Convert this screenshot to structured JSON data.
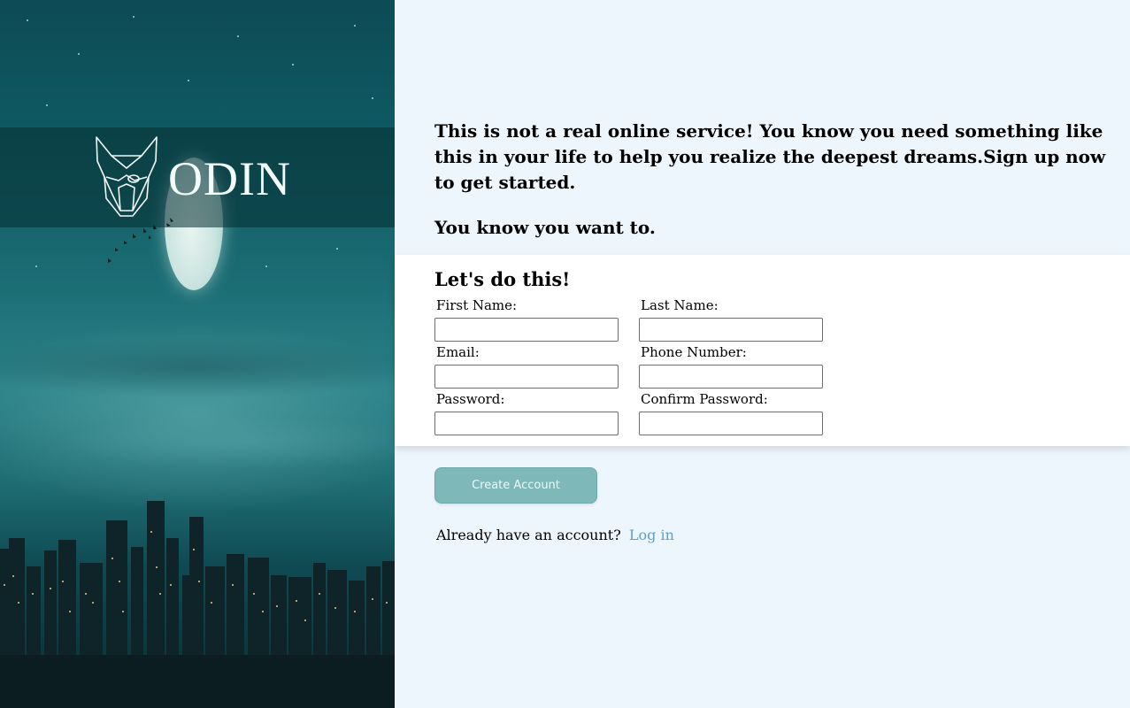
{
  "brand": {
    "name": "ODIN",
    "logo_icon": "viking-helmet-icon"
  },
  "intro": {
    "paragraph1": "This is not a real online service! You know you need something like this in your life to help you realize the deepest dreams.Sign up now to get started.",
    "paragraph2": "You know you want to."
  },
  "form": {
    "title": "Let's do this!",
    "fields": {
      "first_name": {
        "label": "First Name:",
        "value": ""
      },
      "last_name": {
        "label": "Last Name:",
        "value": ""
      },
      "email": {
        "label": "Email:",
        "value": ""
      },
      "phone": {
        "label": "Phone Number:",
        "value": ""
      },
      "password": {
        "label": "Password:",
        "value": ""
      },
      "confirm_password": {
        "label": "Confirm Password:",
        "value": ""
      }
    }
  },
  "actions": {
    "create_account": "Create Account",
    "login_prompt": "Already have an account?",
    "login_link": "Log in"
  },
  "colors": {
    "page_background": "#eef6fd",
    "button": "#7fb8b8",
    "link": "#5aa0c8"
  }
}
